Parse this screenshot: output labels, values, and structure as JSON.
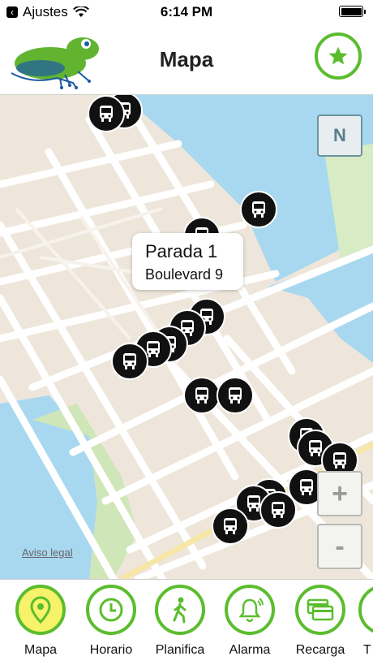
{
  "status_bar": {
    "back_label": "Ajustes",
    "time": "6:14 PM"
  },
  "header": {
    "title": "Mapa"
  },
  "map": {
    "north_label": "N",
    "zoom_in_label": "+",
    "zoom_out_label": "-",
    "legal_label": "Aviso legal",
    "callout": {
      "title": "Parada 1",
      "subtitle": "Boulevard 9"
    }
  },
  "tabs": [
    {
      "label": "Mapa",
      "icon": "map-pin-icon",
      "active": true
    },
    {
      "label": "Horario",
      "icon": "clock-icon",
      "active": false
    },
    {
      "label": "Planifica",
      "icon": "walking-person-icon",
      "active": false
    },
    {
      "label": "Alarma",
      "icon": "bell-icon",
      "active": false
    },
    {
      "label": "Recarga",
      "icon": "cards-icon",
      "active": false
    },
    {
      "label": "T",
      "icon": "more-icon",
      "active": false
    }
  ],
  "colors": {
    "accent": "#5bbd2e",
    "water": "#a8d8f0",
    "land": "#eee6da",
    "park": "#cfe6b9",
    "active_tab": "#f6f26a"
  }
}
